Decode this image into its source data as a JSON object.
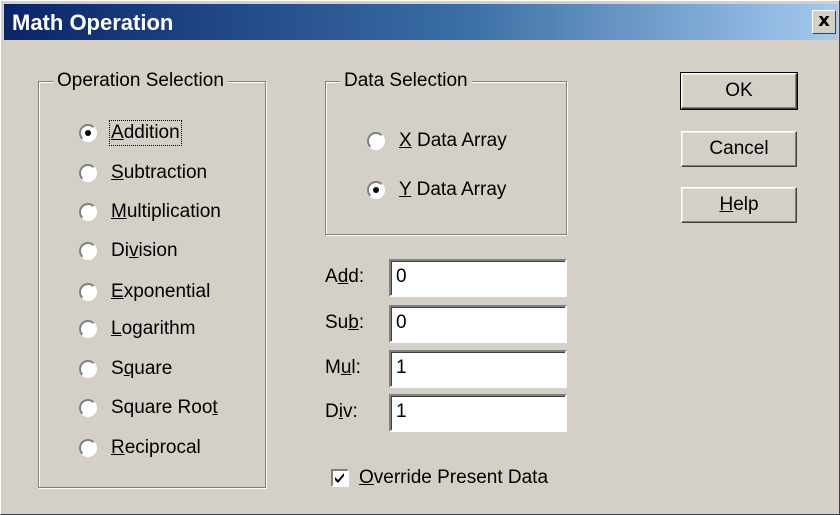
{
  "window": {
    "title": "Math Operation",
    "close_label": "x"
  },
  "operation_group": {
    "label": "Operation Selection",
    "options": [
      {
        "pre": "",
        "u": "A",
        "post": "ddition",
        "selected": true
      },
      {
        "pre": "",
        "u": "S",
        "post": "ubtraction",
        "selected": false
      },
      {
        "pre": "",
        "u": "M",
        "post": "ultiplication",
        "selected": false
      },
      {
        "pre": "Di",
        "u": "v",
        "post": "ision",
        "selected": false
      },
      {
        "pre": "",
        "u": "E",
        "post": "xponential",
        "selected": false
      },
      {
        "pre": "",
        "u": "L",
        "post": "ogarithm",
        "selected": false
      },
      {
        "pre": "S",
        "u": "q",
        "post": "uare",
        "selected": false
      },
      {
        "pre": "Square Roo",
        "u": "t",
        "post": "",
        "selected": false
      },
      {
        "pre": "",
        "u": "R",
        "post": "eciprocal",
        "selected": false
      }
    ]
  },
  "data_group": {
    "label": "Data Selection",
    "options": [
      {
        "pre": "",
        "u": "X",
        "post": " Data Array",
        "selected": false
      },
      {
        "pre": "",
        "u": "Y",
        "post": " Data Array",
        "selected": true
      }
    ]
  },
  "fields": [
    {
      "pre": "A",
      "u": "d",
      "post": "d:",
      "value": "0"
    },
    {
      "pre": "Su",
      "u": "b",
      "post": ":",
      "value": "0"
    },
    {
      "pre": "M",
      "u": "u",
      "post": "l:",
      "value": "1"
    },
    {
      "pre": "D",
      "u": "i",
      "post": "v:",
      "value": "1"
    }
  ],
  "override": {
    "pre": "",
    "u": "O",
    "post": "verride Present Data",
    "checked": true
  },
  "buttons": {
    "ok": "OK",
    "cancel": "Cancel",
    "help": {
      "pre": "",
      "u": "H",
      "post": "elp"
    }
  }
}
